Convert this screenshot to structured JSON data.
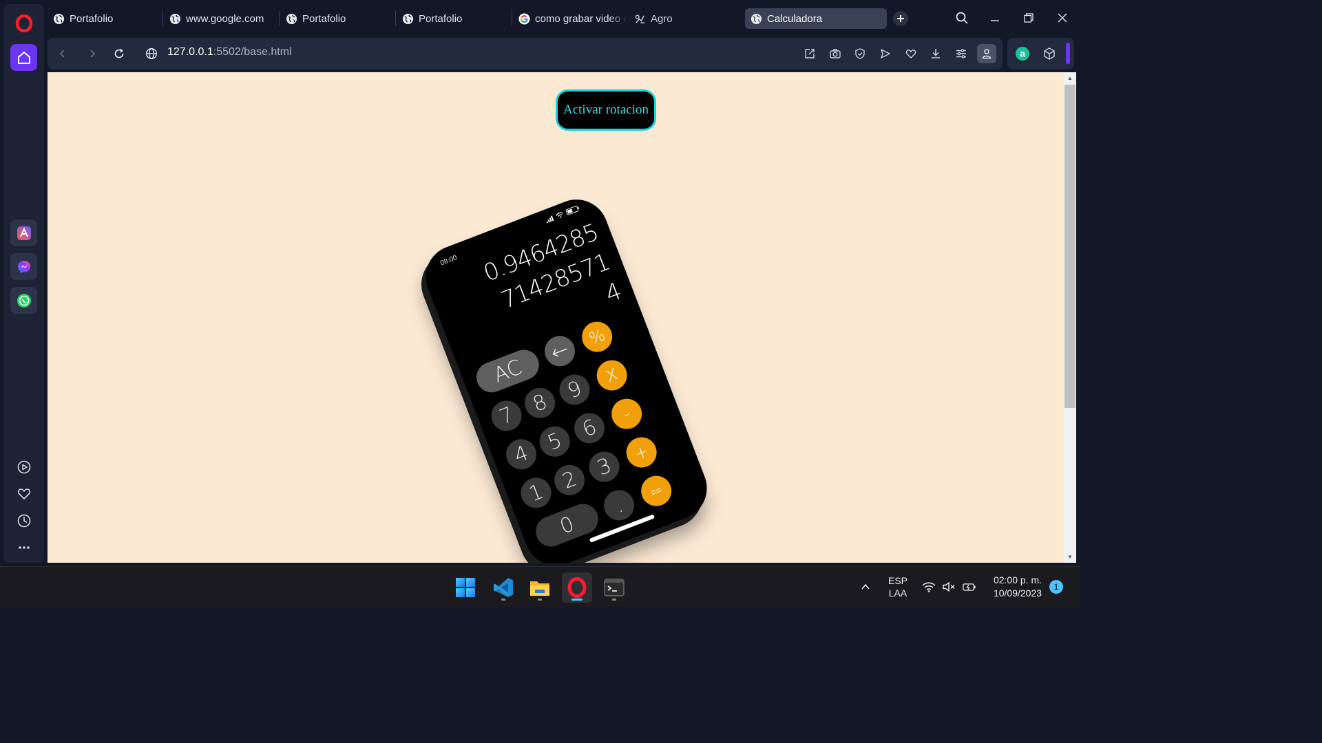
{
  "browser": {
    "tabs": [
      {
        "title": "Portafolio",
        "icon": "globe-icon"
      },
      {
        "title": "www.google.com",
        "icon": "globe-icon"
      },
      {
        "title": "Portafolio",
        "icon": "globe-icon"
      },
      {
        "title": "Portafolio",
        "icon": "globe-icon"
      },
      {
        "title": "como grabar video c",
        "icon": "google-icon"
      },
      {
        "title": "Agro",
        "icon": "agro-icon"
      },
      {
        "title": "Calculadora",
        "icon": "globe-icon",
        "active": true
      }
    ],
    "address": {
      "host": "127.0.0.1",
      "rest": ":5502/base.html"
    },
    "accent_color": "#6b35f5"
  },
  "page": {
    "background": "#fbe9d4",
    "rotate_button_label": "Activar rotacion",
    "phone": {
      "status_time": "08:00",
      "display_lines": [
        "0.9464285",
        "71428571",
        "4"
      ],
      "keys": [
        {
          "label": "AC",
          "type": "light",
          "wide": true
        },
        {
          "label": "←",
          "type": "light"
        },
        {
          "label": "%",
          "type": "orange"
        },
        {
          "label": "7",
          "type": "dark"
        },
        {
          "label": "8",
          "type": "dark"
        },
        {
          "label": "9",
          "type": "dark"
        },
        {
          "label": "X",
          "type": "orange"
        },
        {
          "label": "4",
          "type": "dark"
        },
        {
          "label": "5",
          "type": "dark"
        },
        {
          "label": "6",
          "type": "dark"
        },
        {
          "label": "-",
          "type": "orange"
        },
        {
          "label": "1",
          "type": "dark"
        },
        {
          "label": "2",
          "type": "dark"
        },
        {
          "label": "3",
          "type": "dark"
        },
        {
          "label": "+",
          "type": "orange"
        },
        {
          "label": "0",
          "type": "dark",
          "wide": true
        },
        {
          "label": ".",
          "type": "dark"
        },
        {
          "label": "=",
          "type": "orange"
        }
      ]
    }
  },
  "taskbar": {
    "language": "ESP",
    "layout": "LAA",
    "time": "02:00 p. m.",
    "date": "10/09/2023",
    "notifications": "1"
  }
}
